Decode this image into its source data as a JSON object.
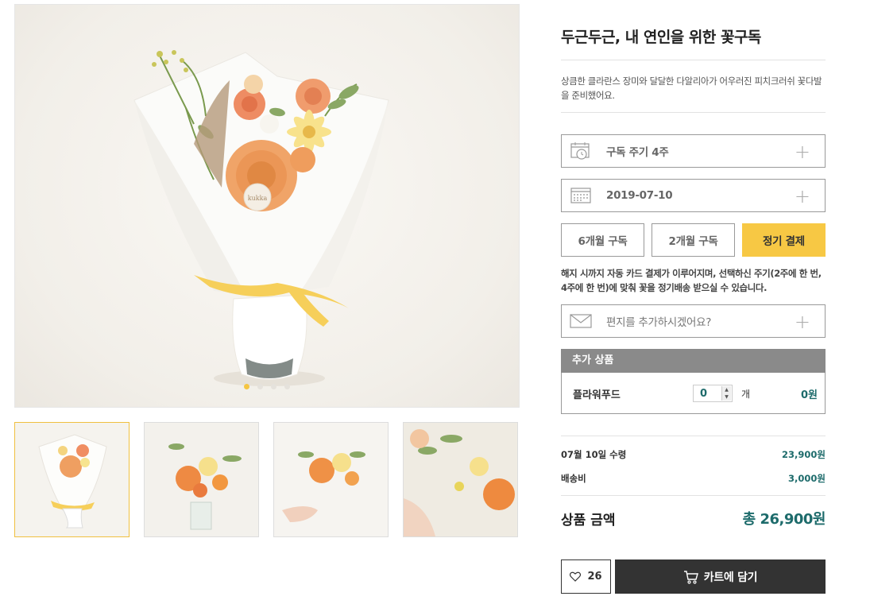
{
  "product": {
    "title": "두근두근, 내 연인을 위한 꽃구독",
    "description": "상큼한 클라란스 장미와 달달한 다알리아가 어우러진 피치크러쉬 꽃다발을 준비했어요."
  },
  "gallery": {
    "tag_text": "kukka",
    "active_dot": 0,
    "dot_count": 4,
    "thumbnail_count": 4
  },
  "options": {
    "cycle_label": "구독 주기 4주",
    "date_label": "2019-07-10",
    "letter_label": "편지를 추가하시겠어요?",
    "plus_symbol": "+"
  },
  "subscription": {
    "buttons": [
      "6개월 구독",
      "2개월 구독",
      "정기 결제"
    ],
    "selected_index": 2,
    "notice": "해지 시까지 자동 카드 결제가 이루어지며, 선택하신 주기(2주에 한 번, 4주에 한 번)에 맞춰 꽃을 정기배송 받으실 수 있습니다."
  },
  "extra": {
    "header": "추가 상품",
    "item_name": "플라워푸드",
    "quantity": "0",
    "unit": "개",
    "price": "0원"
  },
  "summary": {
    "receive_label": "07월 10일 수령",
    "receive_price": "23,900원",
    "shipping_label": "배송비",
    "shipping_price": "3,000원",
    "total_label": "상품 금액",
    "total_value": "총 26,900원"
  },
  "actions": {
    "like_count": "26",
    "cart_label": "카트에 담기"
  },
  "colors": {
    "accent_yellow": "#f7c844",
    "price_teal": "#1d6b6b",
    "dark_button": "#333333"
  }
}
